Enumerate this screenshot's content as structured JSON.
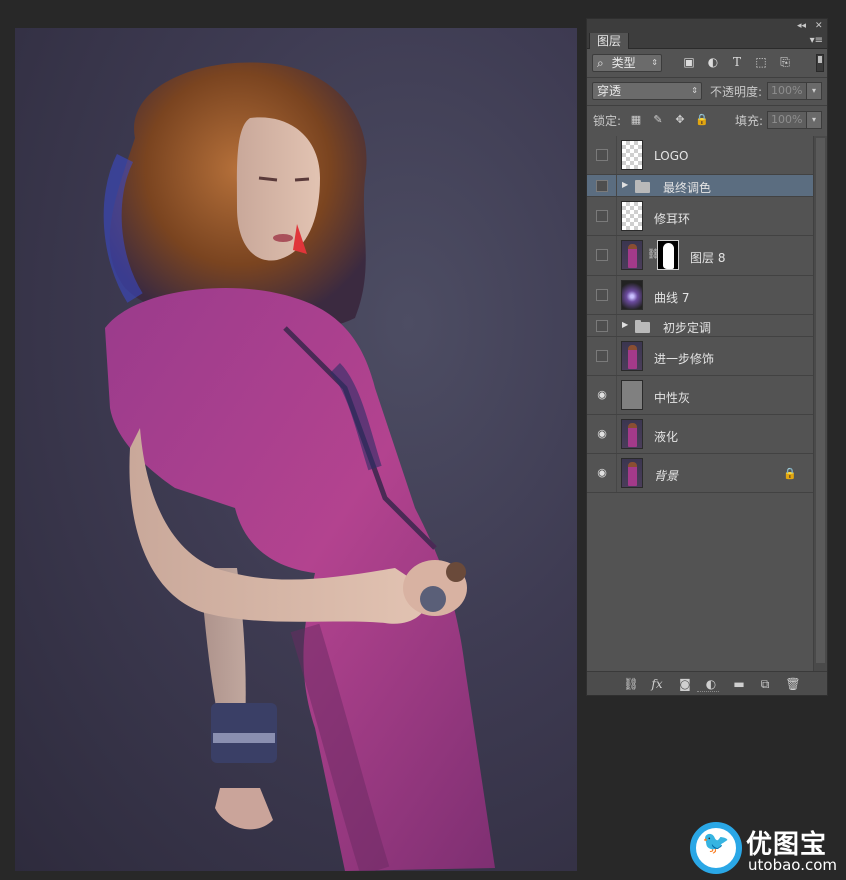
{
  "panel": {
    "collapse_glyph": "◂◂",
    "close_glyph": "✕",
    "tab_label": "图层",
    "menu_glyph": "▾≡"
  },
  "filter": {
    "search_glyph": "⌕",
    "kind_label": "类型",
    "icons": [
      "image-filter-icon",
      "adjustment-filter-icon",
      "type-filter-icon",
      "shape-filter-icon",
      "smart-object-filter-icon"
    ]
  },
  "blend": {
    "mode": "穿透",
    "opacity_label": "不透明度:",
    "opacity_value": "100%"
  },
  "lock": {
    "label": "锁定:",
    "fill_label": "填充:",
    "fill_value": "100%"
  },
  "layers": [
    {
      "name": "LOGO",
      "kind": "pixel",
      "thumb": "transparent",
      "visible": false
    },
    {
      "name": "最终调色",
      "kind": "group",
      "visible": false,
      "selected": true
    },
    {
      "name": "修耳环",
      "kind": "pixel",
      "thumb": "transparent",
      "visible": false
    },
    {
      "name": "图层 8",
      "kind": "masked",
      "thumb": "photo",
      "visible": false
    },
    {
      "name": "曲线 7",
      "kind": "pixel",
      "thumb": "curves",
      "visible": false
    },
    {
      "name": "初步定调",
      "kind": "group",
      "visible": false
    },
    {
      "name": "进一步修饰",
      "kind": "pixel",
      "thumb": "photo",
      "visible": false
    },
    {
      "name": "中性灰",
      "kind": "pixel",
      "thumb": "grey",
      "visible": true
    },
    {
      "name": "液化",
      "kind": "pixel",
      "thumb": "photo",
      "visible": true
    },
    {
      "name": "背景",
      "kind": "background",
      "thumb": "photo",
      "visible": true,
      "locked": true
    }
  ],
  "bottom_icons": [
    "link-layers-icon",
    "fx-icon",
    "layer-mask-icon",
    "new-adjustment-icon",
    "new-group-icon",
    "new-layer-icon",
    "trash-icon"
  ],
  "watermark": {
    "brand": "优图宝",
    "url": "utobao.com"
  },
  "colors": {
    "panel_bg": "#535353",
    "selected_row": "#5b6d80",
    "workspace_bg": "#282828",
    "watermark_blue": "#2aa7e6"
  }
}
